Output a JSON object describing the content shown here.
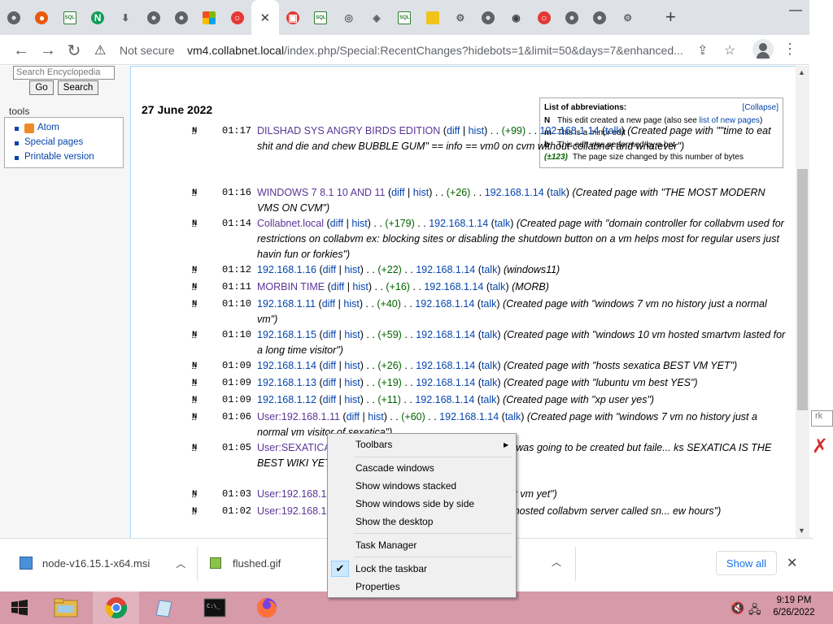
{
  "browser": {
    "tabs": [
      {
        "icon": "globe-icon",
        "color": "#5f6368",
        "letter": ""
      },
      {
        "icon": "red-circle-icon",
        "color": "#e8590c",
        "letter": "●"
      },
      {
        "icon": "sql-icon",
        "color": "#2e7d32",
        "letter": "SQL"
      },
      {
        "icon": "nginx-icon",
        "color": "#0f9d58",
        "letter": "N"
      },
      {
        "icon": "download-icon",
        "color": "#5f6368",
        "letter": "⬇"
      },
      {
        "icon": "globe-icon",
        "color": "#5f6368",
        "letter": ""
      },
      {
        "icon": "globe-icon",
        "color": "#5f6368",
        "letter": ""
      },
      {
        "icon": "windows-logo-icon",
        "color": "#f25022",
        "letter": ""
      },
      {
        "icon": "red-ring-icon",
        "color": "#e53935",
        "letter": "○"
      },
      {
        "icon": "close-icon",
        "color": "#3c4043",
        "letter": "✕",
        "active": true
      },
      {
        "icon": "red-box-icon",
        "color": "#e53935",
        "letter": "▣"
      },
      {
        "icon": "sql-icon",
        "color": "#2e7d32",
        "letter": "SQL"
      },
      {
        "icon": "chrome-icon",
        "color": "#5f6368",
        "letter": "◎"
      },
      {
        "icon": "diamond-icon",
        "color": "#5f6368",
        "letter": "◈"
      },
      {
        "icon": "sql-icon",
        "color": "#2e7d32",
        "letter": "SQL"
      },
      {
        "icon": "folder-icon",
        "color": "#f0c419",
        "letter": "▮"
      },
      {
        "icon": "gear-icon",
        "color": "#5f6368",
        "letter": "⚙"
      },
      {
        "icon": "globe-icon",
        "color": "#5f6368",
        "letter": ""
      },
      {
        "icon": "shield-icon",
        "color": "#3c4043",
        "letter": "◉"
      },
      {
        "icon": "red-ring-icon",
        "color": "#e53935",
        "letter": "○"
      },
      {
        "icon": "globe-icon",
        "color": "#5f6368",
        "letter": ""
      },
      {
        "icon": "globe-icon",
        "color": "#5f6368",
        "letter": ""
      },
      {
        "icon": "gear-icon",
        "color": "#5f6368",
        "letter": "⚙"
      }
    ],
    "new_tab": "+",
    "minimize": "—",
    "not_secure": "Not secure",
    "url_host": "vm4.collabnet.local",
    "url_path": "/index.php/Special:RecentChanges?hidebots=1&limit=50&days=7&enhanced..."
  },
  "sidebar": {
    "search_placeholder": "Search Encyclopedia",
    "go": "Go",
    "search": "Search",
    "tools_label": "tools",
    "tools": [
      "Atom",
      "Special pages",
      "Printable version"
    ]
  },
  "content": {
    "date_heading": "27 June 2022",
    "abbr": {
      "title": "List of abbreviations:",
      "collapse": "[Collapse]",
      "rows": [
        {
          "key": "N",
          "text": "This edit created a new page (also see ",
          "link": "list of new pages",
          "tail": ")"
        },
        {
          "key": "m",
          "text": "This is a minor edit",
          "link": "",
          "tail": ""
        },
        {
          "key": "b",
          "text": "This edit was performed by a bot",
          "link": "",
          "tail": ""
        },
        {
          "key": "(±123)",
          "text": "The page size changed by this number of bytes",
          "link": "",
          "tail": ""
        }
      ]
    },
    "entries": [
      {
        "time": "01:17",
        "title": "DILSHAD SYS ANGRY BIRDS EDITION",
        "visited": true,
        "size": "(+99)",
        "user": "192.168.1.14",
        "comment": "(Created page with \"\"time to eat shit and die and chew BUBBLE GUM\" == info == vm0 on cvm without collabnet and whatever\")"
      },
      {
        "time": "01:16",
        "title": "WINDOWS 7 8.1 10 AND 11",
        "visited": true,
        "size": "(+26)",
        "user": "192.168.1.14",
        "comment": "(Created page with \"THE MOST MODERN VMS ON CVM\")"
      },
      {
        "time": "01:14",
        "title": "Collabnet.local",
        "visited": true,
        "size": "(+179)",
        "user": "192.168.1.14",
        "comment": "(Created page with \"domain controller for collabvm used for restrictions on collabvm ex: blocking sites or disabling the shutdown button on a vm helps most for regular users just havin fun or forkies\")"
      },
      {
        "time": "01:12",
        "title": "192.168.1.16",
        "visited": false,
        "size": "(+22)",
        "user": "192.168.1.14",
        "comment": "(windows11)"
      },
      {
        "time": "01:11",
        "title": "MORBIN TIME",
        "visited": true,
        "size": "(+16)",
        "user": "192.168.1.14",
        "comment": "(MORB)"
      },
      {
        "time": "01:10",
        "title": "192.168.1.11",
        "visited": false,
        "size": "(+40)",
        "user": "192.168.1.14",
        "comment": "(Created page with \"windows 7 vm no history just a normal vm\")"
      },
      {
        "time": "01:10",
        "title": "192.168.1.15",
        "visited": false,
        "size": "(+59)",
        "user": "192.168.1.14",
        "comment": "(Created page with \"windows 10 vm hosted smartvm lasted for a long time visitor\")"
      },
      {
        "time": "01:09",
        "title": "192.168.1.14",
        "visited": false,
        "size": "(+26)",
        "user": "192.168.1.14",
        "comment": "(Created page with \"hosts sexatica BEST VM YET\")"
      },
      {
        "time": "01:09",
        "title": "192.168.1.13",
        "visited": false,
        "size": "(+19)",
        "user": "192.168.1.14",
        "comment": "(Created page with \"lubuntu vm best YES\")"
      },
      {
        "time": "01:09",
        "title": "192.168.1.12",
        "visited": false,
        "size": "(+11)",
        "user": "192.168.1.14",
        "comment": "(Created page with \"xp user yes\")"
      },
      {
        "time": "01:06",
        "title": "User:192.168.1.11",
        "visited": true,
        "size": "(+60)",
        "user": "192.168.1.14",
        "comment": "(Created page with \"windows 7 vm no history just a normal vm visitor of sexatica\")"
      },
      {
        "time": "01:05",
        "title": "User:SEXATICA",
        "visited": true,
        "size": "",
        "user": "",
        "comment": "14 (talk) (Created page with \"a user that was going to be created but faile... ks SEXATICA IS THE BEST WIKI YET PLEASE DO NOT BLAME THEM\")"
      },
      {
        "time": "01:03",
        "title": "User:192.168.1",
        "visited": true,
        "size": "",
        "user": "",
        "comment": "lk) (Created page with \"runs sexatica best vm yet\")"
      },
      {
        "time": "01:02",
        "title": "User:192.168.1",
        "visited": true,
        "size": "",
        "user": "",
        "comment": "lk) (Created page with \"windows 10 user hosted collabvm server called sn... ew hours\")"
      }
    ],
    "flag": "N",
    "diff": "diff",
    "hist": "hist",
    "talk": "talk",
    "sep_dots": ". .",
    "pipe": "|"
  },
  "downloads": {
    "items": [
      {
        "name": "node-v16.15.1-x64.msi"
      },
      {
        "name": "flushed.gif"
      }
    ],
    "show_all": "Show all"
  },
  "context_menu": {
    "toolbars": "Toolbars",
    "cascade": "Cascade windows",
    "stacked": "Show windows stacked",
    "side_by_side": "Show windows side by side",
    "desktop": "Show the desktop",
    "task_manager": "Task Manager",
    "lock": "Lock the taskbar",
    "properties": "Properties",
    "lock_checked": true
  },
  "taskbar": {
    "time": "9:19 PM",
    "date": "6/26/2022",
    "color": "#d79aa9"
  }
}
